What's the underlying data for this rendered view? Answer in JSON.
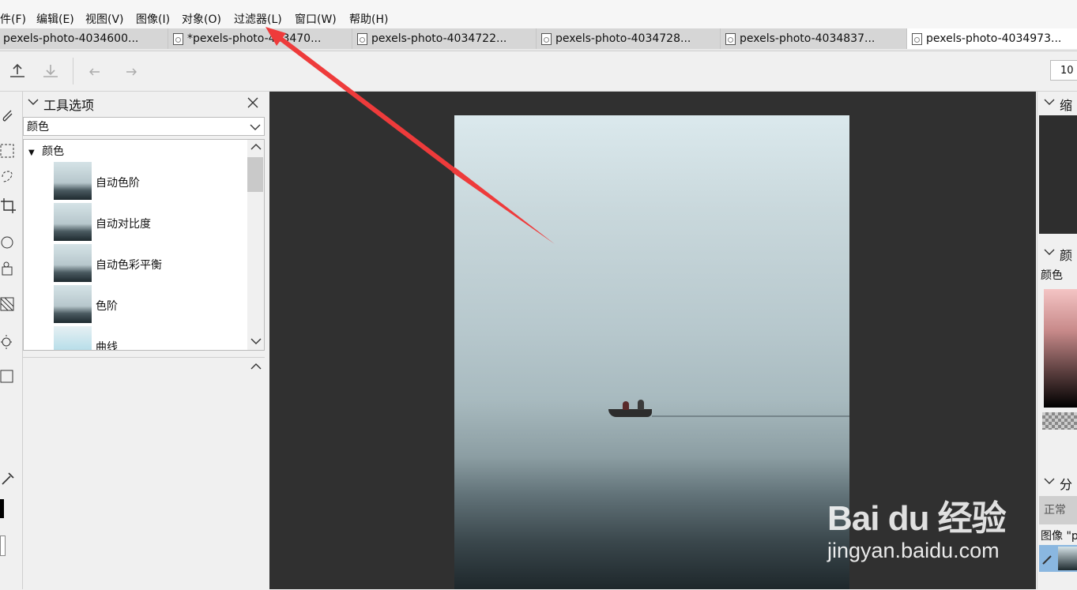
{
  "menu": [
    "件(F)",
    "编辑(E)",
    "视图(V)",
    "图像(I)",
    "对象(O)",
    "过滤器(L)",
    "窗口(W)",
    "帮助(H)"
  ],
  "tabs": [
    {
      "label": "pexels-photo-4034600...",
      "icon": false
    },
    {
      "label": "*pexels-photo-403470...",
      "icon": true
    },
    {
      "label": "pexels-photo-4034722...",
      "icon": true
    },
    {
      "label": "pexels-photo-4034728...",
      "icon": true
    },
    {
      "label": "pexels-photo-4034837...",
      "icon": true
    },
    {
      "label": "pexels-photo-4034973...",
      "icon": true,
      "active": true
    }
  ],
  "toolbar": {
    "zoom": "10"
  },
  "tool_options": {
    "title": "工具选项",
    "combo_value": "颜色",
    "group_label": "颜色",
    "items": [
      "自动色阶",
      "自动对比度",
      "自动色彩平衡",
      "色阶",
      "曲线"
    ]
  },
  "right_dock": {
    "navigator_title": "缩",
    "color_title": "颜",
    "color_tab": "颜色",
    "layers_title": "分",
    "blend_mode": "正常",
    "layer_name": "图像 \"p"
  },
  "watermark": {
    "brand": "Bai du 经验",
    "url": "jingyan.baidu.com"
  },
  "colors": {
    "annotation_arrow": "#ee3b3b",
    "canvas_bg": "#303030",
    "layer_selected": "#8ab7e0"
  }
}
